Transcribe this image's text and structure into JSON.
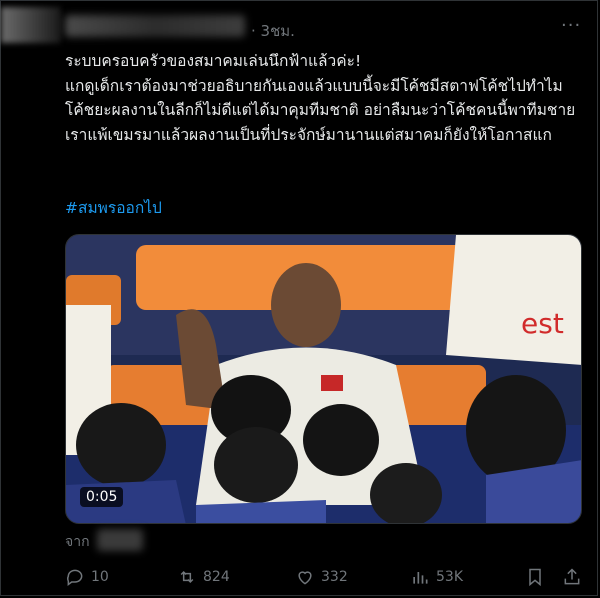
{
  "post": {
    "time": "· 3ชม.",
    "more_label": "···",
    "text": "ระบบครอบครัวของสมาคมเล่นนึกฟ้าแล้วค่ะ!\nแกดูเด็กเราต้องมาช่วยอธิบายกันเองแล้วแบบนี้จะมีโค้ชมีสตาฟโค้ชไปทำไม\nโค้ชยะผลงานในลีกก็ไม่ดีแต่ได้มาคุมทีมชาติ อย่าลืมนะว่าโค้ชคนนี้พาทีมชายเราแพ้เขมรมาแล้วผลงานเป็นที่ประจักษ์มานานแต่สมาคมก็ยังให้โอกาสแก",
    "hashtag": "#สมพรออกไป"
  },
  "media": {
    "duration": "0:05",
    "from_label": "จาก"
  },
  "actions": {
    "replies": "10",
    "reposts": "824",
    "likes": "332",
    "views": "53K"
  },
  "colors": {
    "background": "#000000",
    "text": "#e7e9ea",
    "muted": "#71767b",
    "link": "#1d9bf0"
  }
}
